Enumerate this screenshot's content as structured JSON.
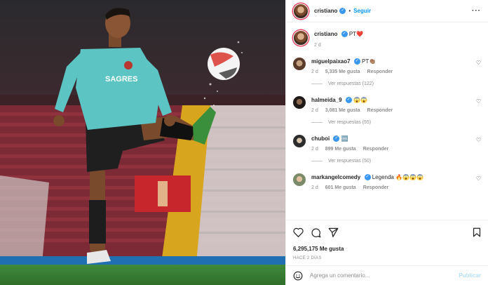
{
  "post": {
    "author": "cristiano",
    "follow_label": "Seguir",
    "caption_text": "PT❤️",
    "caption_time": "2 d",
    "likes": "6,295,175 Me gusta",
    "date": "HACE 2 DÍAS"
  },
  "comments": [
    {
      "user": "miguelpaixao7",
      "text": "PT👏🏽",
      "time": "2 d",
      "likes": "5,335 Me gusta",
      "reply": "Responder",
      "replies": "Ver respuestas (122)"
    },
    {
      "user": "halmeida_9",
      "text": "😱😱",
      "time": "2 d",
      "likes": "3,081 Me gusta",
      "reply": "Responder",
      "replies": "Ver respuestas (55)"
    },
    {
      "user": "chuboi",
      "text": "🆒",
      "time": "2 d",
      "likes": "899 Me gusta",
      "reply": "Responder",
      "replies": "Ver respuestas (50)"
    },
    {
      "user": "markangelcomedy",
      "text": "Legenda 🔥😱😱😱",
      "time": "2 d",
      "likes": "601 Me gusta",
      "reply": "Responder"
    }
  ],
  "photo": {
    "shirt_brand": "SAGRES"
  },
  "composer": {
    "placeholder": "Agrega un comentario...",
    "publish_label": "Publicar"
  },
  "colors": {
    "follow_blue": "#0095f6",
    "verified_blue": "#3897f0",
    "muted": "#8e8e8e",
    "publish_disabled": "#b2dffc"
  }
}
